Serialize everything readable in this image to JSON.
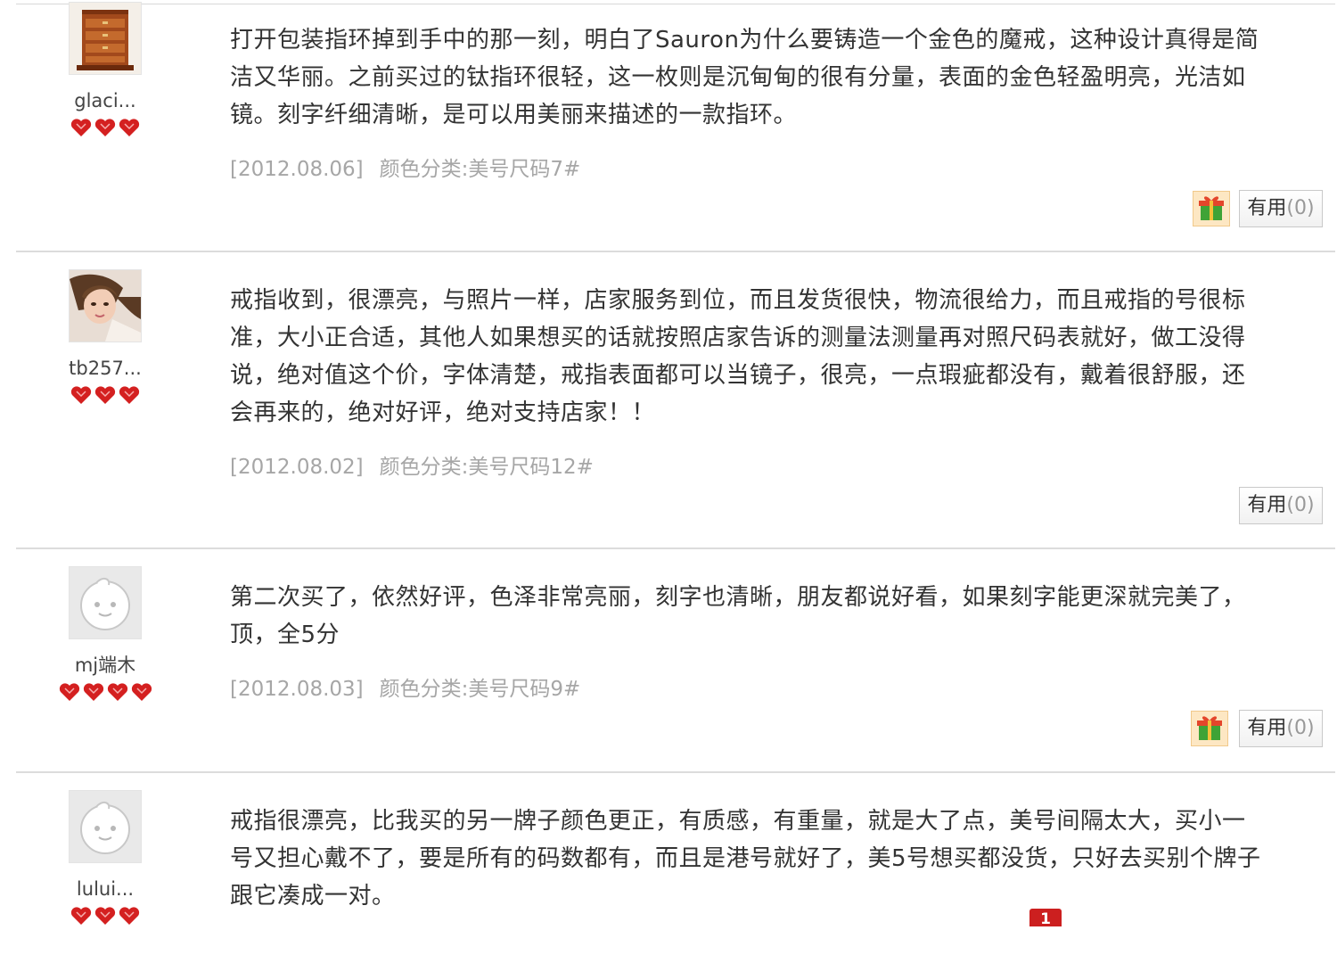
{
  "reviews": [
    {
      "username": "glaci...",
      "hearts": 3,
      "text": "打开包装指环掉到手中的那一刻，明白了Sauron为什么要铸造一个金色的魔戒，这种设计真得是简洁又华丽。之前买过的钛指环很轻，这一枚则是沉甸甸的很有分量，表面的金色轻盈明亮，光洁如镜。刻字纤细清晰，是可以用美丽来描述的一款指环。",
      "date": "[2012.08.06]",
      "sku": "颜色分类:美号尺码7#",
      "has_gift": true,
      "useful_label": "有用",
      "useful_count": "(0)",
      "avatar": "wooden-box-avatar"
    },
    {
      "username": "tb257...",
      "hearts": 3,
      "text": "戒指收到，很漂亮，与照片一样，店家服务到位，而且发货很快，物流很给力，而且戒指的号很标准，大小正合适，其他人如果想买的话就按照店家告诉的测量法测量再对照尺码表就好，做工没得说，绝对值这个价，字体清楚，戒指表面都可以当镜子，很亮，一点瑕疵都没有，戴着很舒服，还会再来的，绝对好评，绝对支持店家！！",
      "date": "[2012.08.02]",
      "sku": "颜色分类:美号尺码12#",
      "has_gift": false,
      "useful_label": "有用",
      "useful_count": "(0)",
      "avatar": "girl-photo-avatar"
    },
    {
      "username": "mj端木",
      "hearts": 4,
      "text": "第二次买了，依然好评，色泽非常亮丽，刻字也清晰，朋友都说好看，如果刻字能更深就完美了，顶，全5分",
      "date": "[2012.08.03]",
      "sku": "颜色分类:美号尺码9#",
      "has_gift": true,
      "useful_label": "有用",
      "useful_count": "(0)",
      "avatar": "default-face-avatar"
    },
    {
      "username": "lului...",
      "hearts": 3,
      "text": "戒指很漂亮，比我买的另一牌子颜色更正，有质感，有重量，就是大了点，美号间隔太大，买小一号又担心戴不了，要是所有的码数都有，而且是港号就好了，美5号想买都没货，只好去买别个牌子跟它凑成一对。",
      "avatar": "default-face-avatar"
    }
  ],
  "page_badge": "1",
  "colors": {
    "heart": "#d42020",
    "meta_text": "#a6a6a6",
    "badge": "#cc1f1f"
  }
}
